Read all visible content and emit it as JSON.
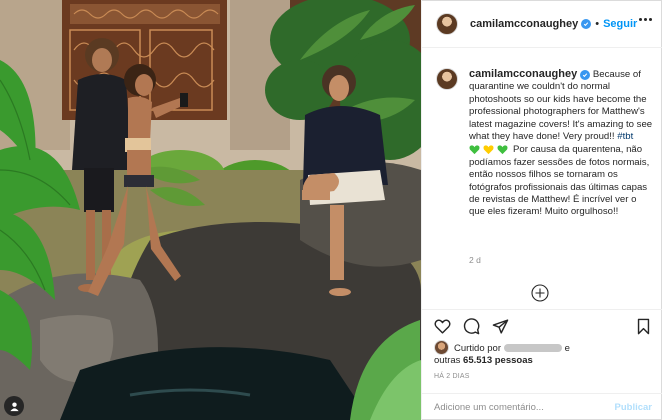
{
  "post": {
    "author": "camilamcconaughey",
    "follow_label": "Seguir",
    "caption_en": "Because of quarantine we couldn't do normal photoshoots so our kids have become the professional photographers for Matthew's latest magazine covers! It's amazing to see what they have done! Very proud!! ",
    "hashtag": "#tbt",
    "caption_pt": " Por causa da quarentena, não podíamos fazer sessões de fotos normais, então nossos filhos se tornaram os fotógrafos profissionais das últimas capas de revistas de Matthew! É incrível ver o que eles fizeram! Muito orgulhoso!!",
    "heart_colors": [
      "#3fbf3f",
      "#ffcc00",
      "#3fbf3f"
    ],
    "time_ago": "2 d",
    "liked_prefix": "Curtido por",
    "liked_suffix_text": "outras",
    "liked_count": "65.513 pessoas",
    "date": "HÁ 2 DIAS",
    "comment_placeholder": "Adicione um comentário...",
    "publish_label": "Publicar"
  },
  "icons": {
    "header": [
      "verified-badge-icon",
      "more-options-icon"
    ],
    "actions": [
      "heart-icon",
      "comment-icon",
      "share-icon",
      "bookmark-icon"
    ],
    "other": [
      "load-more-comments-icon",
      "user-tag-icon"
    ]
  },
  "colors": {
    "accent": "#0095f6",
    "verified": "#3897f0",
    "hashtag": "#00376b",
    "muted": "#8e8e8e"
  }
}
